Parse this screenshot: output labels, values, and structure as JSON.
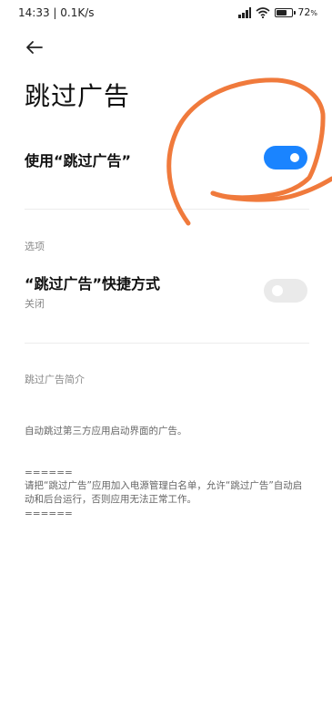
{
  "status_bar": {
    "time_speed": "14:33 | 0.1K/s",
    "battery_percent": "72",
    "battery_unit": "%",
    "battery_level": 0.72,
    "icons": [
      "signal-hd-icon",
      "wifi-icon",
      "battery-icon"
    ]
  },
  "nav": {
    "back_icon": "arrow-left-icon"
  },
  "title": "跳过广告",
  "use_toggle": {
    "label": "使用“跳过广告”",
    "state": "on",
    "color": "#1a84ff"
  },
  "options_section": {
    "label": "选项"
  },
  "shortcut": {
    "label": "“跳过广告”快捷方式",
    "status": "关闭",
    "state": "off"
  },
  "intro": {
    "label": "跳过广告简介",
    "description": "自动跳过第三方应用启动界面的广告。",
    "separator_top": "======",
    "note": "请把“跳过广告”应用加入电源管理白名单，允许“跳过广告”自动启动和后台运行，否则应用无法正常工作。",
    "separator_bottom": "======"
  },
  "annotation_color": "#f07a3c"
}
